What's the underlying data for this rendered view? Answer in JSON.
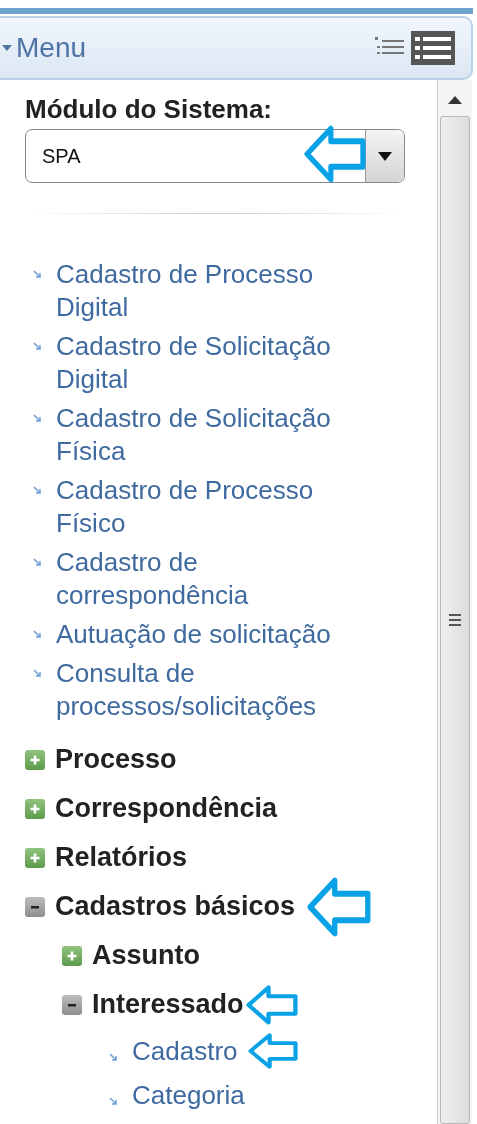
{
  "menu": {
    "title": "Menu",
    "expanded": true
  },
  "module": {
    "label": "Módulo do Sistema:",
    "value": "SPA",
    "highlighted": true
  },
  "links": [
    {
      "label": "Cadastro de Processo Digital"
    },
    {
      "label": "Cadastro de Solicitação Digital"
    },
    {
      "label": "Cadastro de Solicitação Física"
    },
    {
      "label": "Cadastro de Processo Físico"
    },
    {
      "label": "Cadastro de correspondência"
    },
    {
      "label": "Autuação de solicitação"
    },
    {
      "label": "Consulta de processos/solicitações"
    }
  ],
  "tree": [
    {
      "kind": "folder",
      "label": "Processo",
      "expanded": false,
      "highlighted": false
    },
    {
      "kind": "folder",
      "label": "Correspondência",
      "expanded": false,
      "highlighted": false
    },
    {
      "kind": "folder",
      "label": "Relatórios",
      "expanded": false,
      "highlighted": false
    },
    {
      "kind": "folder",
      "label": "Cadastros básicos",
      "expanded": true,
      "highlighted": true,
      "children": [
        {
          "kind": "folder",
          "label": "Assunto",
          "expanded": false,
          "highlighted": false
        },
        {
          "kind": "folder",
          "label": "Interessado",
          "expanded": true,
          "highlighted": true,
          "children": [
            {
              "kind": "link",
              "label": "Cadastro",
              "highlighted": true
            },
            {
              "kind": "link",
              "label": "Categoria",
              "highlighted": false
            }
          ]
        }
      ]
    }
  ]
}
